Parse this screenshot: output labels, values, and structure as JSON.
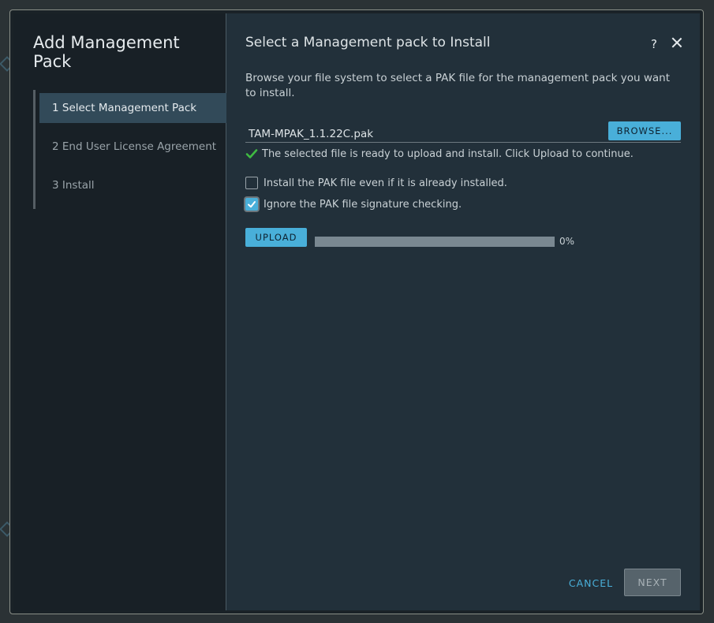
{
  "wizard": {
    "title": "Add Management Pack",
    "steps": [
      {
        "label": "1  Select Management Pack",
        "active": true
      },
      {
        "label": "2  End User License Agreement",
        "active": false
      },
      {
        "label": "3  Install",
        "active": false
      }
    ]
  },
  "page": {
    "title": "Select a Management pack to Install",
    "help_label": "?",
    "description": "Browse your file system to select a PAK file for the management pack you want to install."
  },
  "file": {
    "name": "TAM-MPAK_1.1.22C.pak",
    "browse_label": "BROWSE...",
    "status": "The selected file is ready to upload and install. Click Upload to continue."
  },
  "options": {
    "force_install": {
      "label": "Install the PAK file even if it is already installed.",
      "checked": false
    },
    "ignore_signature": {
      "label": "Ignore the PAK file signature checking.",
      "checked": true
    }
  },
  "upload": {
    "button_label": "UPLOAD",
    "progress_text": "0%",
    "progress_value": 0
  },
  "footer": {
    "cancel_label": "CANCEL",
    "next_label": "NEXT"
  },
  "colors": {
    "accent": "#49afd9",
    "success": "#3fba42"
  }
}
